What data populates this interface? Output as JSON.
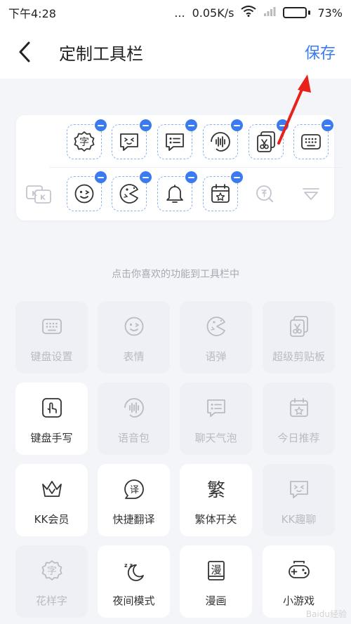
{
  "status_bar": {
    "time": "下午4:28",
    "dots": "...",
    "speed": "0.05K/s",
    "battery": "73%",
    "battery_level": 0.73
  },
  "header": {
    "title": "定制工具栏",
    "save_label": "保存"
  },
  "toolbar": {
    "row1": [
      {
        "icon": "hua-yang-zi-icon",
        "removable": true
      },
      {
        "icon": "kk-chat-icon",
        "removable": true
      },
      {
        "icon": "chat-bubble-icon",
        "removable": true
      },
      {
        "icon": "voice-pack-icon",
        "removable": true
      },
      {
        "icon": "clipboard-icon",
        "removable": true
      },
      {
        "icon": "keyboard-icon",
        "removable": true
      }
    ],
    "row2": [
      {
        "icon": "kk-logo-icon",
        "removable": false
      },
      {
        "icon": "emoji-icon",
        "removable": true
      },
      {
        "icon": "yu-dan-icon",
        "removable": true
      },
      {
        "icon": "bell-icon",
        "removable": true
      },
      {
        "icon": "calendar-icon",
        "removable": true
      },
      {
        "icon": "search-icon",
        "removable": false
      },
      {
        "icon": "collapse-icon",
        "removable": false
      }
    ]
  },
  "hint": "点击你喜欢的功能到工具栏中",
  "tiles": [
    {
      "label": "键盘设置",
      "icon": "keyboard-icon",
      "active": false
    },
    {
      "label": "表情",
      "icon": "emoji-icon",
      "active": false
    },
    {
      "label": "语弹",
      "icon": "yu-dan-icon",
      "active": false
    },
    {
      "label": "超级剪贴板",
      "icon": "clipboard-icon",
      "active": false
    },
    {
      "label": "键盘手写",
      "icon": "handwriting-icon",
      "active": true
    },
    {
      "label": "语音包",
      "icon": "voice-pack-icon",
      "active": false
    },
    {
      "label": "聊天气泡",
      "icon": "chat-bubble-icon",
      "active": false
    },
    {
      "label": "今日推荐",
      "icon": "calendar-icon",
      "active": false
    },
    {
      "label": "KK会员",
      "icon": "crown-icon",
      "active": true
    },
    {
      "label": "快捷翻译",
      "icon": "translate-icon",
      "active": true
    },
    {
      "label": "繁体开关",
      "icon": "traditional-icon",
      "active": true
    },
    {
      "label": "KK趣聊",
      "icon": "kk-chat-icon",
      "active": false
    },
    {
      "label": "花样字",
      "icon": "hua-yang-zi-icon",
      "active": false
    },
    {
      "label": "夜间模式",
      "icon": "moon-icon",
      "active": true
    },
    {
      "label": "漫画",
      "icon": "comic-icon",
      "active": true
    },
    {
      "label": "小游戏",
      "icon": "gamepad-icon",
      "active": true
    }
  ],
  "glyphs": {
    "zi": "字",
    "yi": "译",
    "fan": "繁",
    "man": "漫",
    "kk": "KK",
    "zz": "z z"
  },
  "colors": {
    "accent": "#3a7bf0",
    "annotation": "#e8211a",
    "active_icon": "#333333",
    "inactive_icon": "#b8bbc4"
  },
  "watermark": "Baidu经验"
}
